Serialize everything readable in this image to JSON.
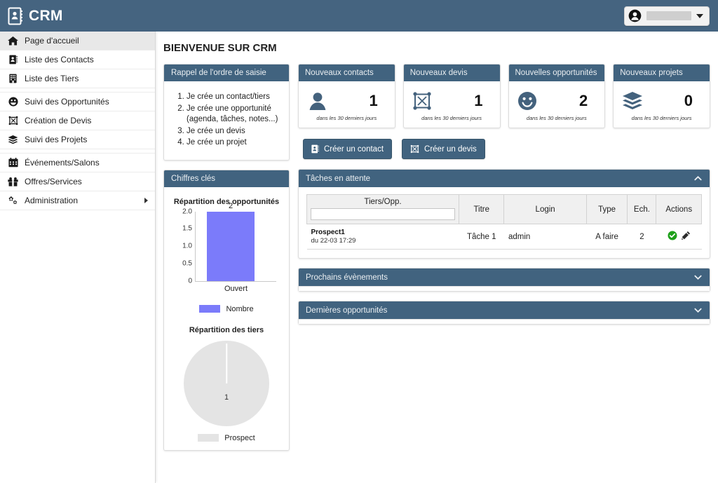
{
  "header": {
    "brand": "CRM",
    "brand_icon": "contact-book-icon",
    "user_menu": {
      "avatar_icon": "user-circle-icon",
      "name": "",
      "caret_icon": "chevron-down-icon"
    }
  },
  "sidebar": {
    "items": [
      {
        "label": "Page d'accueil",
        "icon": "home-icon",
        "active": true,
        "has_submenu": false
      },
      {
        "label": "Liste des Contacts",
        "icon": "contact-card-icon",
        "active": false,
        "has_submenu": false
      },
      {
        "label": "Liste des Tiers",
        "icon": "building-icon",
        "active": false,
        "has_submenu": false
      },
      {
        "label": "Suivi des Opportunités",
        "icon": "smiley-icon",
        "active": false,
        "has_submenu": false
      },
      {
        "label": "Création de Devis",
        "icon": "quote-box-icon",
        "active": false,
        "has_submenu": false
      },
      {
        "label": "Suivi des Projets",
        "icon": "layers-icon",
        "active": false,
        "has_submenu": false
      },
      {
        "label": "Événements/Salons",
        "icon": "calendar-icon",
        "active": false,
        "has_submenu": false
      },
      {
        "label": "Offres/Services",
        "icon": "gift-icon",
        "active": false,
        "has_submenu": false
      },
      {
        "label": "Administration",
        "icon": "gears-icon",
        "active": false,
        "has_submenu": true
      }
    ]
  },
  "main": {
    "page_title": "BIENVENUE SUR CRM",
    "reminder_panel": {
      "title": "Rappel de l'ordre de saisie",
      "steps": [
        "Je crée un contact/tiers",
        "Je crée une opportunité",
        "Je crée un devis",
        "Je crée un projet"
      ],
      "step2_sub": "(agenda, tâches, notes...)"
    },
    "kpi_panel_title": "Chiffres clés",
    "kpis": [
      {
        "title": "Nouveaux contacts",
        "value": "1",
        "caption": "dans les 30 derniers jours",
        "icon": "person-icon"
      },
      {
        "title": "Nouveaux devis",
        "value": "1",
        "caption": "dans les 30 derniers jours",
        "icon": "quote-box-icon"
      },
      {
        "title": "Nouvelles opportunités",
        "value": "2",
        "caption": "dans les 30 derniers jours",
        "icon": "smiley-icon"
      },
      {
        "title": "Nouveaux projets",
        "value": "0",
        "caption": "dans les 30 derniers jours",
        "icon": "layers-icon"
      }
    ],
    "buttons": [
      {
        "label": "Créer un contact",
        "icon": "contact-card-icon"
      },
      {
        "label": "Créer un devis",
        "icon": "quote-box-icon"
      }
    ],
    "tasks_panel": {
      "title": "Tâches en attente",
      "collapse_icon": "chevron-up-icon",
      "columns": [
        "Tiers/Opp.",
        "Titre",
        "Login",
        "Type",
        "Ech.",
        "Actions"
      ],
      "filter_value": "",
      "filter_placeholder": "",
      "rows": [
        {
          "tiers_name": "Prospect1",
          "tiers_date": "du 22-03 17:29",
          "titre": "Tâche 1",
          "login": "admin",
          "type": "A faire",
          "ech": "2",
          "actions": [
            "check-circle-icon",
            "pencil-icon"
          ]
        }
      ]
    },
    "collapsed_panels": [
      {
        "title": "Prochains évènements",
        "icon": "chevron-down-icon"
      },
      {
        "title": "Dernières opportunités",
        "icon": "chevron-down-icon"
      }
    ]
  },
  "colors": {
    "header_blue": "#456480",
    "panel_blue": "#41637f",
    "bar_purple": "#7b7bfa",
    "pie_gray": "#e4e4e4",
    "check_green": "#1ea01a"
  },
  "chart_data": [
    {
      "type": "bar",
      "title": "Répartition des opportunités",
      "categories": [
        "Ouvert"
      ],
      "values": [
        2
      ],
      "series": [
        {
          "name": "Nombre",
          "values": [
            2
          ],
          "color": "#7b7bfa"
        }
      ],
      "data_labels": [
        "2"
      ],
      "yticks": [
        "2.0",
        "1.5",
        "1.0",
        "0.5",
        "0"
      ],
      "ylim": [
        0,
        2
      ],
      "xlabel": "",
      "ylabel": "",
      "legend": [
        "Nombre"
      ],
      "legend_position": "bottom",
      "grid": false
    },
    {
      "type": "pie",
      "title": "Répartition des tiers",
      "categories": [
        "Prospect"
      ],
      "values": [
        1
      ],
      "data_labels": [
        "1"
      ],
      "legend": [
        "Prospect"
      ],
      "legend_position": "bottom",
      "colors": [
        "#e4e4e4"
      ]
    }
  ]
}
